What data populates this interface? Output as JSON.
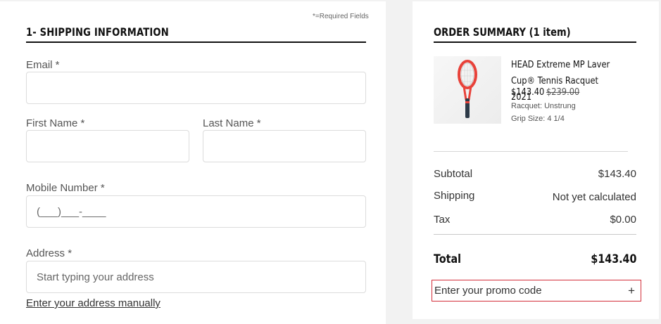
{
  "shipping": {
    "required_note": "*=Required Fields",
    "title": "1- SHIPPING INFORMATION",
    "email": {
      "label": "Email *",
      "value": "",
      "placeholder": ""
    },
    "first_name": {
      "label": "First Name *",
      "value": "",
      "placeholder": ""
    },
    "last_name": {
      "label": "Last Name *",
      "value": "",
      "placeholder": ""
    },
    "mobile": {
      "label": "Mobile Number *",
      "value": "",
      "placeholder": "(___)___-____"
    },
    "address": {
      "label": "Address *",
      "value": "",
      "placeholder": "Start typing your address"
    },
    "manual_link": "Enter your address manually"
  },
  "summary": {
    "title": "ORDER SUMMARY (1 item)",
    "product": {
      "name": "HEAD Extreme MP Laver Cup® Tennis Racquet 2021",
      "price": "$143.40",
      "original_price": "$239.00",
      "attributes": [
        "Racquet: Unstrung",
        "Grip Size: 4 1/4"
      ],
      "image_icon": "tennis-racquet"
    },
    "subtotal_label": "Subtotal",
    "subtotal_value": "$143.40",
    "shipping_label": "Shipping",
    "shipping_value": "Not yet calculated",
    "tax_label": "Tax",
    "tax_value": "$0.00",
    "total_label": "Total",
    "total_value": "$143.40",
    "promo_text": "Enter your promo code",
    "promo_icon": "+"
  },
  "colors": {
    "page_bg": "#f2f2f2",
    "promo_border": "#d32f3a",
    "racquet_frame": "#e8423a",
    "racquet_shaft": "#2d3a48"
  }
}
